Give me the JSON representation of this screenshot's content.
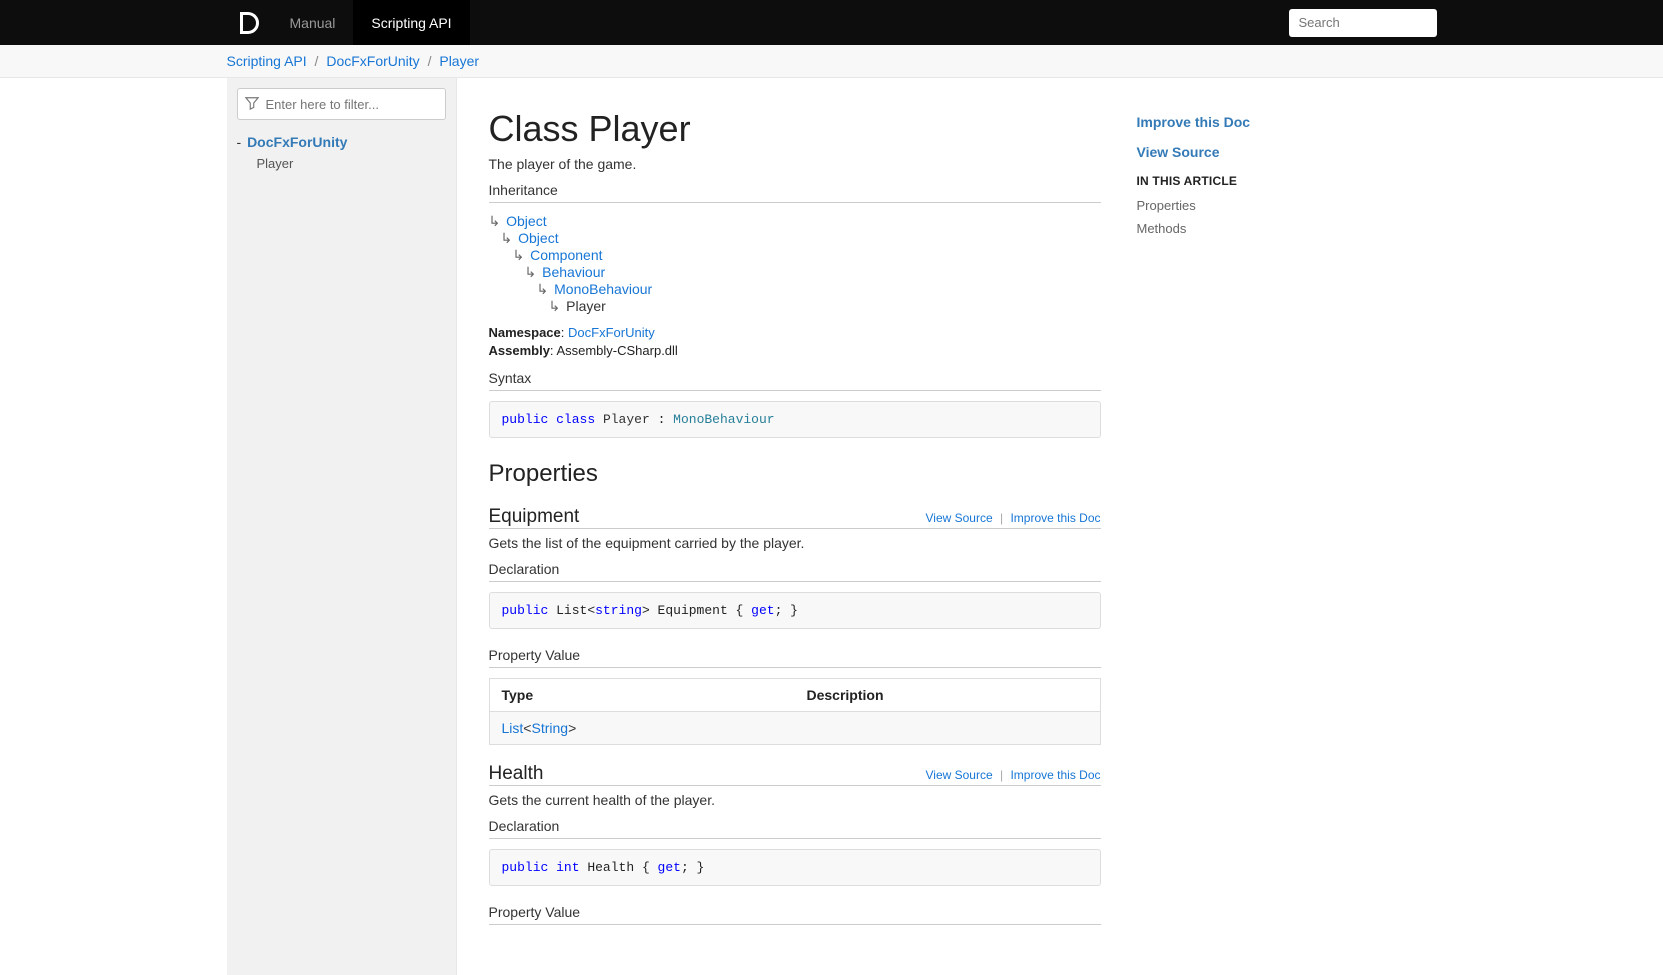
{
  "header": {
    "tab_manual": "Manual",
    "tab_api": "Scripting API",
    "search_placeholder": "Search"
  },
  "breadcrumb": {
    "items": [
      "Scripting API",
      "DocFxForUnity",
      "Player"
    ]
  },
  "sidebar": {
    "filter_placeholder": "Enter here to filter...",
    "root_label": "DocFxForUnity",
    "child_label": "Player"
  },
  "affix": {
    "improve": "Improve this Doc",
    "view_source": "View Source",
    "in_this_article": "IN THIS ARTICLE",
    "item_properties": "Properties",
    "item_methods": "Methods"
  },
  "page": {
    "title": "Class Player",
    "summary": "The player of the game.",
    "inheritance_label": "Inheritance",
    "inheritance": [
      "Object",
      "Object",
      "Component",
      "Behaviour",
      "MonoBehaviour",
      "Player"
    ],
    "namespace_label": "Namespace",
    "namespace_value": "DocFxForUnity",
    "assembly_label": "Assembly",
    "assembly_value": "Assembly-CSharp.dll",
    "syntax_label": "Syntax",
    "properties_heading": "Properties",
    "declaration_label": "Declaration",
    "property_value_label": "Property Value",
    "table_type": "Type",
    "table_description": "Description",
    "link_view_source": "View Source",
    "link_improve": "Improve this Doc"
  },
  "properties": {
    "equipment": {
      "name": "Equipment",
      "desc": "Gets the list of the equipment carried by the player.",
      "type_outer": "List",
      "type_inner": "String"
    },
    "health": {
      "name": "Health",
      "desc": "Gets the current health of the player."
    }
  }
}
